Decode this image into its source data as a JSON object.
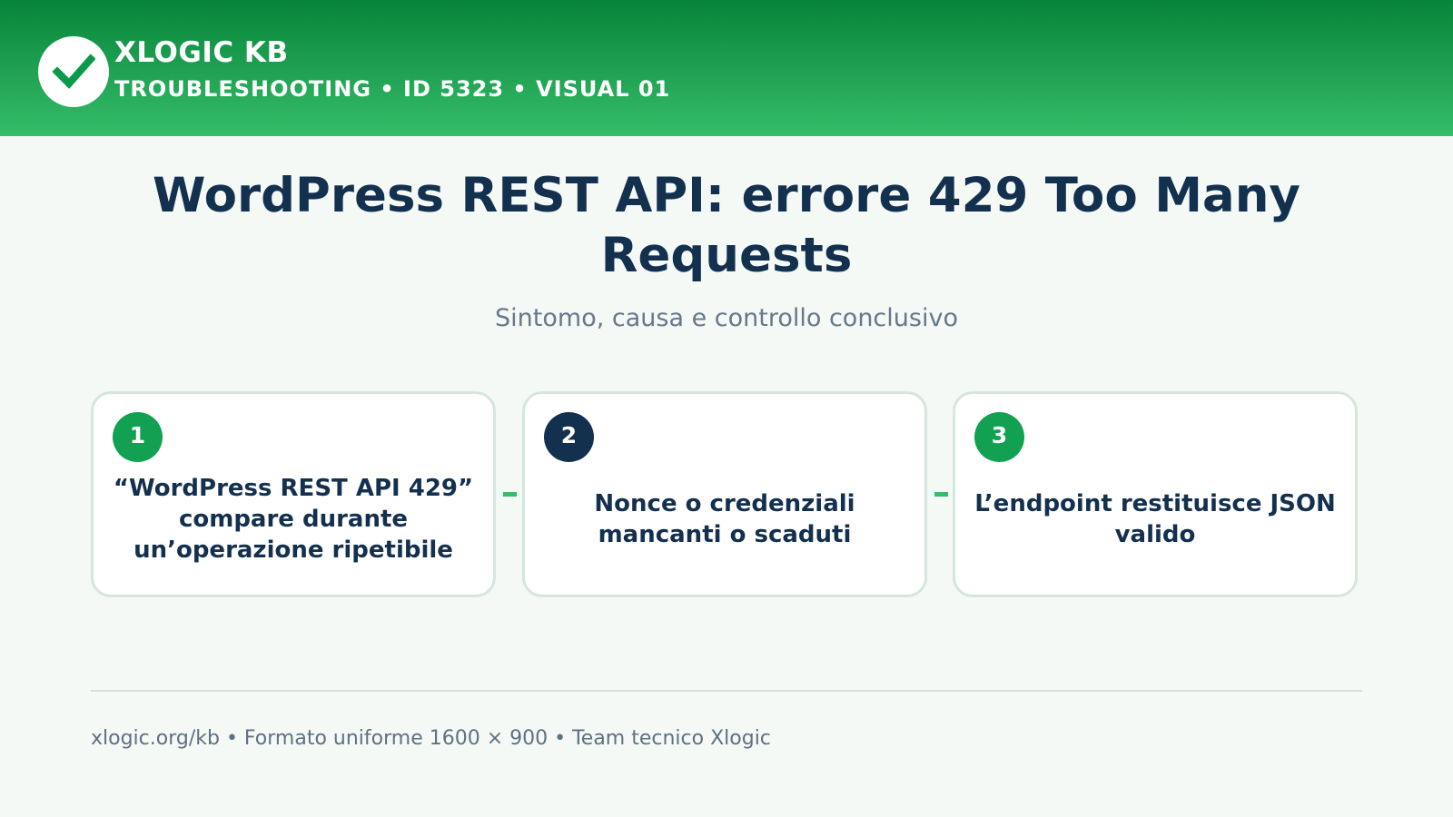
{
  "header": {
    "brand": "XLOGIC KB",
    "breadcrumb": "TROUBLESHOOTING • ID 5323 • VISUAL 01",
    "logo_icon": "check-icon",
    "gradient_top": "#07843a",
    "gradient_bottom": "#35bd69"
  },
  "title": "WordPress REST API: errore 429 Too Many Requests",
  "subtitle": "Sintomo, causa e controllo conclusivo",
  "steps": [
    {
      "number": "1",
      "text": "“WordPress REST API 429” compare durante un’operazione ripetibile",
      "color": "#12a152"
    },
    {
      "number": "2",
      "text": "Nonce o credenziali mancanti o scaduti",
      "color": "#14304f"
    },
    {
      "number": "3",
      "text": "L’endpoint restituisce JSON valido",
      "color": "#12a152"
    }
  ],
  "footer": "xlogic.org/kb • Formato uniforme 1600 × 900 • Team tecnico Xlogic",
  "colors": {
    "primary_text": "#14304f",
    "accent": "#35bd69",
    "background": "#f4f9f6"
  }
}
